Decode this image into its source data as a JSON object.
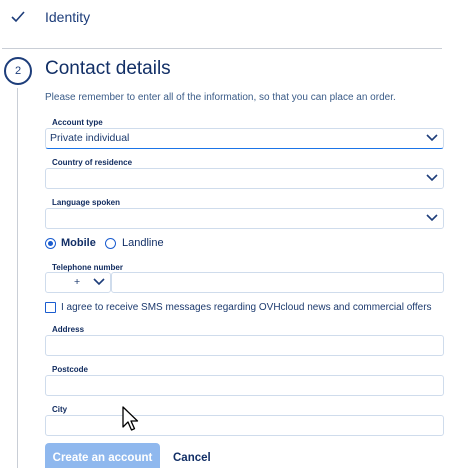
{
  "steps": {
    "identity": {
      "label": "Identity",
      "status": "complete"
    },
    "contact": {
      "number": "2",
      "title": "Contact details"
    }
  },
  "intro_text": "Please remember to enter all of the information, so that you can place an order.",
  "account_type": {
    "label": "Account type",
    "value": "Private individual"
  },
  "country": {
    "label": "Country of residence",
    "value": ""
  },
  "language": {
    "label": "Language spoken",
    "value": ""
  },
  "phone_type": {
    "options": [
      "Mobile",
      "Landline"
    ],
    "selected": "Mobile"
  },
  "telephone": {
    "label": "Telephone number",
    "prefix": "+",
    "value": ""
  },
  "sms_consent": {
    "label": "I agree to receive SMS messages regarding OVHcloud news and commercial offers",
    "checked": false
  },
  "address": {
    "label": "Address",
    "value": ""
  },
  "postcode": {
    "label": "Postcode",
    "value": ""
  },
  "city": {
    "label": "City",
    "value": ""
  },
  "buttons": {
    "create": "Create an account",
    "cancel": "Cancel"
  },
  "colors": {
    "primary": "#122f66",
    "accent": "#1a5ccf",
    "disabled_button": "#8fb8ee"
  }
}
